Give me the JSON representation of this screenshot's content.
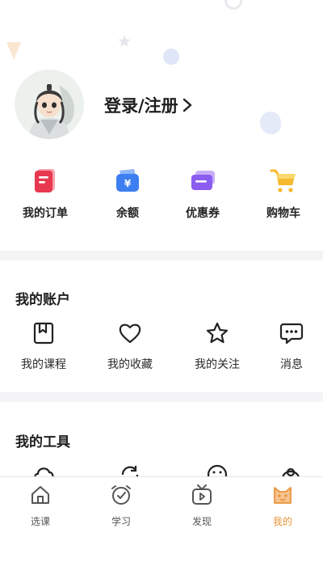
{
  "profile": {
    "login_label": "登录/注册"
  },
  "quick_actions": [
    {
      "label": "我的订单",
      "icon": "order-icon",
      "color": "#e8384f"
    },
    {
      "label": "余额",
      "icon": "wallet-icon",
      "color": "#3d7ff0"
    },
    {
      "label": "优惠券",
      "icon": "coupon-icon",
      "color": "#8b5cf0"
    },
    {
      "label": "购物车",
      "icon": "cart-icon",
      "color": "#f5b82e"
    }
  ],
  "account": {
    "title": "我的账户",
    "items": [
      {
        "label": "我的课程",
        "icon": "bookmark-book-icon"
      },
      {
        "label": "我的收藏",
        "icon": "heart-icon"
      },
      {
        "label": "我的关注",
        "icon": "star-icon"
      },
      {
        "label": "消息",
        "icon": "message-icon"
      }
    ]
  },
  "tools": {
    "title": "我的工具"
  },
  "tabbar": {
    "active_color": "#e8953a",
    "items": [
      {
        "label": "选课",
        "icon": "home-icon"
      },
      {
        "label": "学习",
        "icon": "alarm-clock-icon"
      },
      {
        "label": "发现",
        "icon": "tv-play-icon"
      },
      {
        "label": "我的",
        "icon": "cat-face-icon",
        "active": true
      }
    ]
  }
}
